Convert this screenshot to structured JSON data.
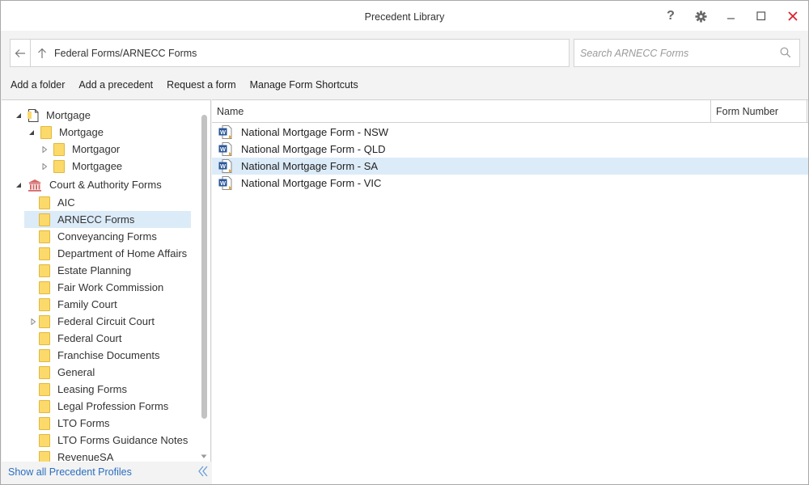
{
  "window": {
    "title": "Precedent Library"
  },
  "address": {
    "path": "Federal Forms/ARNECC Forms"
  },
  "search": {
    "placeholder": "Search ARNECC Forms",
    "value": ""
  },
  "toolbar": {
    "add_folder": "Add a folder",
    "add_precedent": "Add a precedent",
    "request_form": "Request a form",
    "manage_shortcuts": "Manage Form Shortcuts"
  },
  "tree": {
    "items": [
      {
        "label": "Mortgage",
        "icon": "document-icon",
        "expander": "expanded"
      },
      {
        "label": "Mortgage",
        "icon": "folder-icon",
        "expander": "expanded"
      },
      {
        "label": "Mortgagor",
        "icon": "folder-icon",
        "expander": "collapsed"
      },
      {
        "label": "Mortgagee",
        "icon": "folder-icon",
        "expander": "collapsed"
      },
      {
        "label": "Court & Authority Forms",
        "icon": "courthouse-icon",
        "expander": "expanded"
      },
      {
        "label": "AIC",
        "icon": "folder-icon",
        "expander": "none"
      },
      {
        "label": "ARNECC Forms",
        "icon": "folder-icon",
        "expander": "none",
        "selected": true
      },
      {
        "label": "Conveyancing Forms",
        "icon": "folder-icon",
        "expander": "none"
      },
      {
        "label": "Department of Home Affairs",
        "icon": "folder-icon",
        "expander": "none"
      },
      {
        "label": "Estate Planning",
        "icon": "folder-icon",
        "expander": "none"
      },
      {
        "label": "Fair Work Commission",
        "icon": "folder-icon",
        "expander": "none"
      },
      {
        "label": "Family Court",
        "icon": "folder-icon",
        "expander": "none"
      },
      {
        "label": "Federal Circuit Court",
        "icon": "folder-icon",
        "expander": "collapsed"
      },
      {
        "label": "Federal Court",
        "icon": "folder-icon",
        "expander": "none"
      },
      {
        "label": "Franchise Documents",
        "icon": "folder-icon",
        "expander": "none"
      },
      {
        "label": "General",
        "icon": "folder-icon",
        "expander": "none"
      },
      {
        "label": "Leasing Forms",
        "icon": "folder-icon",
        "expander": "none"
      },
      {
        "label": "Legal Profession Forms",
        "icon": "folder-icon",
        "expander": "none"
      },
      {
        "label": "LTO Forms",
        "icon": "folder-icon",
        "expander": "none"
      },
      {
        "label": "LTO Forms Guidance Notes",
        "icon": "folder-icon",
        "expander": "none"
      },
      {
        "label": "RevenueSA",
        "icon": "folder-icon",
        "expander": "none"
      }
    ]
  },
  "footer": {
    "show_all": "Show all Precedent Profiles"
  },
  "list": {
    "columns": {
      "name": "Name",
      "form_number": "Form Number"
    },
    "rows": [
      {
        "name": "National Mortgage Form - NSW",
        "form_number": ""
      },
      {
        "name": "National Mortgage Form - QLD",
        "form_number": ""
      },
      {
        "name": "National Mortgage Form - SA",
        "form_number": "",
        "selected": true
      },
      {
        "name": "National Mortgage Form - VIC",
        "form_number": ""
      }
    ]
  },
  "colors": {
    "selection": "#dcebf8",
    "link": "#2a6ebf",
    "folder": "#fbd96a",
    "close": "#d9232d",
    "word": "#2b579a"
  }
}
